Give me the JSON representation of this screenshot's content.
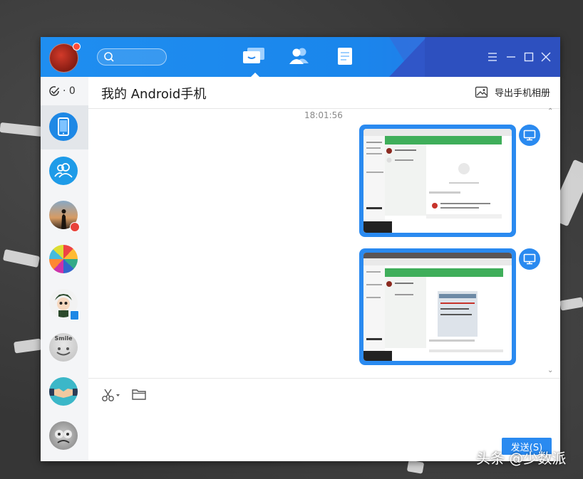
{
  "app": {
    "tabs": [
      {
        "name": "messages",
        "icon": "chat-bubble-icon",
        "active": true
      },
      {
        "name": "contacts",
        "icon": "contacts-icon",
        "active": false
      },
      {
        "name": "files",
        "icon": "document-icon",
        "active": false
      }
    ],
    "window_controls": [
      "menu-icon",
      "minimize-icon",
      "maximize-icon",
      "close-icon"
    ],
    "accent_color": "#2a8af0",
    "titlebar_color": "#1f8ef0"
  },
  "sidebar": {
    "done_count": "· 0",
    "contacts": [
      {
        "name": "android-phone",
        "icon": "phone-icon",
        "selected": true
      },
      {
        "name": "group",
        "icon": "people-icon",
        "selected": false
      },
      {
        "name": "contact-sunset",
        "icon": "avatar-icon",
        "selected": false
      },
      {
        "name": "contact-collage",
        "icon": "avatar-icon",
        "selected": false
      },
      {
        "name": "contact-cartoon",
        "icon": "avatar-icon",
        "selected": false
      },
      {
        "name": "contact-smile",
        "icon": "avatar-icon",
        "selected": false
      },
      {
        "name": "contact-handshake",
        "icon": "avatar-icon",
        "selected": false
      },
      {
        "name": "contact-gray",
        "icon": "avatar-icon",
        "selected": false
      }
    ],
    "smile_text": "Smile"
  },
  "chat": {
    "title": "我的 Android手机",
    "export_label": "导出手机相册",
    "timestamp": "18:01:56"
  },
  "composer": {
    "send_label": "发送(S)"
  },
  "watermark": "头条 @少数派"
}
